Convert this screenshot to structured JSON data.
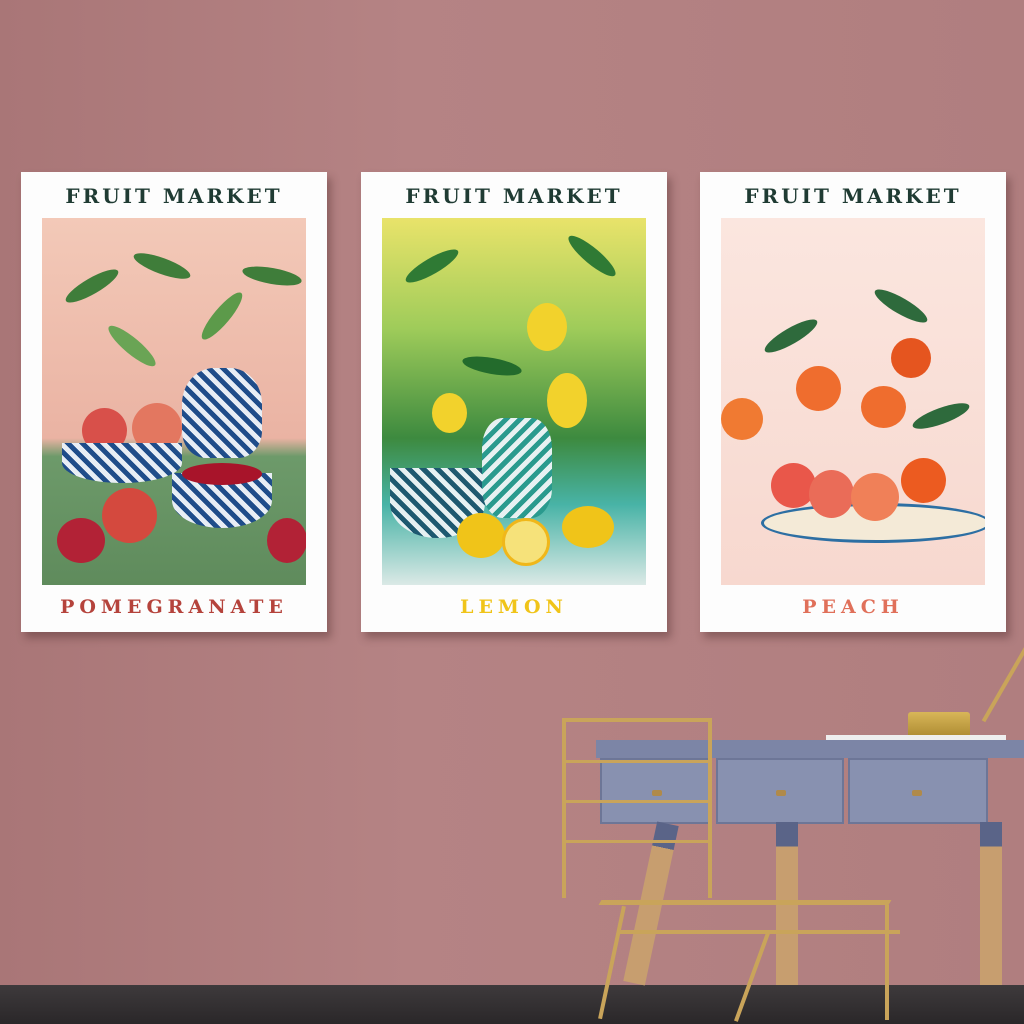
{
  "posters": [
    {
      "heading": "FRUIT MARKET",
      "fruit": "POMEGRANATE",
      "color": "#b5433c"
    },
    {
      "heading": "FRUIT MARKET",
      "fruit": "LEMON",
      "color": "#f0c419"
    },
    {
      "heading": "FRUIT MARKET",
      "fruit": "PEACH",
      "color": "#e0705a"
    }
  ]
}
